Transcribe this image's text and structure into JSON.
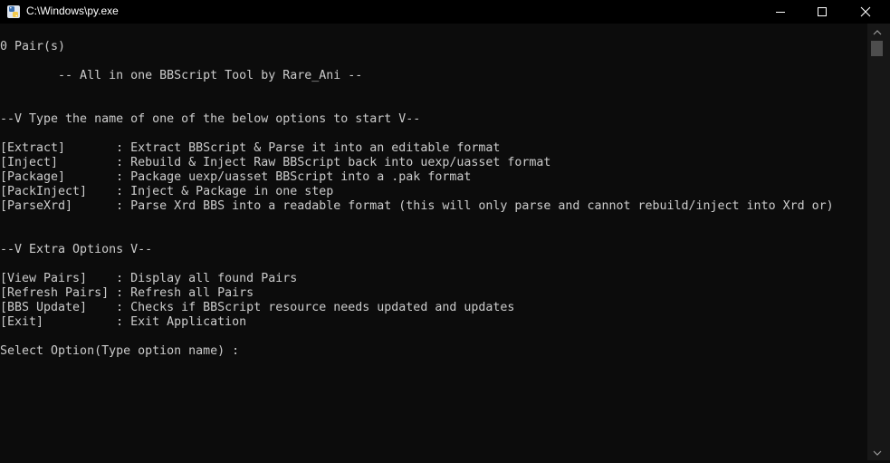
{
  "window": {
    "title": "C:\\Windows\\py.exe",
    "icon": "python-app-icon"
  },
  "controls": {
    "minimize_icon": "minimize-icon",
    "maximize_icon": "maximize-icon",
    "close_icon": "close-icon"
  },
  "console": {
    "pair_count": "0 Pair(s)",
    "banner": "        -- All in one BBScript Tool by Rare_Ani --",
    "main_header": "--V Type the name of one of the below options to start V--",
    "main_options": [
      "[Extract]       : Extract BBScript & Parse it into an editable format",
      "[Inject]        : Rebuild & Inject Raw BBScript back into uexp/uasset format",
      "[Package]       : Package uexp/uasset BBScript into a .pak format",
      "[PackInject]    : Inject & Package in one step",
      "[ParseXrd]      : Parse Xrd BBS into a readable format (this will only parse and cannot rebuild/inject into Xrd or)"
    ],
    "extra_header": "--V Extra Options V--",
    "extra_options": [
      "[View Pairs]    : Display all found Pairs",
      "[Refresh Pairs] : Refresh all Pairs",
      "[BBS Update]    : Checks if BBScript resource needs updated and updates",
      "[Exit]          : Exit Application"
    ],
    "prompt": "Select Option(Type option name) : "
  },
  "colors": {
    "background": "#0c0c0c",
    "text": "#cccccc",
    "titlebar": "#000000"
  }
}
